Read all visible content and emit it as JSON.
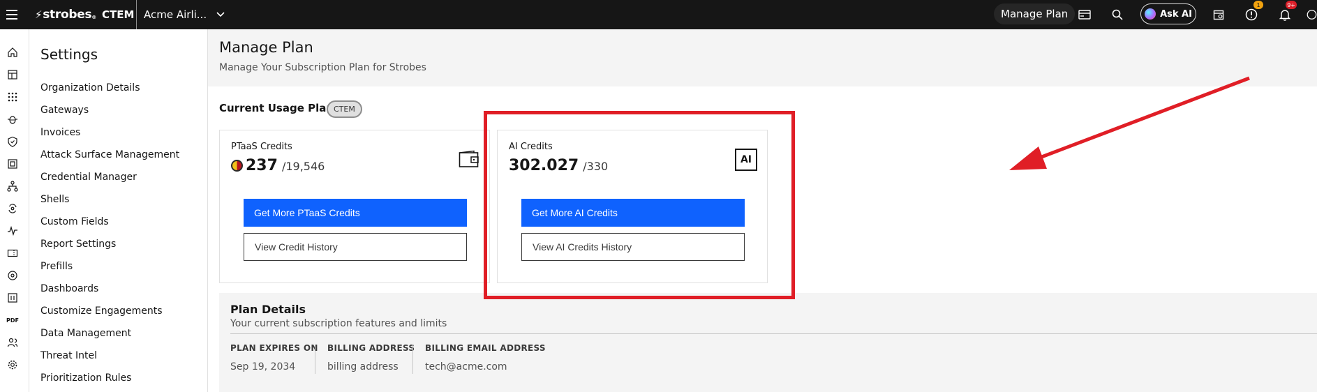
{
  "topbar": {
    "logo": "strobes",
    "product": "CTEM",
    "org": "Acme Airli...",
    "manage_plan": "Manage Plan",
    "ask_ai": "Ask AI",
    "alerts_badge": "1",
    "notifications_badge": "9+"
  },
  "sidebar": {
    "title": "Settings",
    "items": [
      "Organization Details",
      "Gateways",
      "Invoices",
      "Attack Surface Management",
      "Credential Manager",
      "Shells",
      "Custom Fields",
      "Report Settings",
      "Prefills",
      "Dashboards",
      "Customize Engagements",
      "Data Management",
      "Threat Intel",
      "Prioritization Rules"
    ]
  },
  "rail": {
    "pdf_label": "PDF"
  },
  "page": {
    "title": "Manage Plan",
    "subtitle": "Manage Your Subscription Plan for Strobes"
  },
  "usage": {
    "title": "Current Usage Plan",
    "plan_tag": "CTEM",
    "ptaas": {
      "label": "PTaaS Credits",
      "value": "237",
      "total": "/19,546",
      "primary_button": "Get More PTaaS Credits",
      "secondary_button": "View Credit History"
    },
    "ai": {
      "label": "AI Credits",
      "value": "302.027",
      "total": "/330",
      "icon_text": "AI",
      "primary_button": "Get More AI Credits",
      "secondary_button": "View AI Credits History"
    }
  },
  "plan_details": {
    "title": "Plan Details",
    "subtitle": "Your current subscription features and limits",
    "fields": [
      {
        "key": "PLAN EXPIRES ON",
        "value": "Sep 19, 2034"
      },
      {
        "key": "BILLING ADDRESS",
        "value": "billing address"
      },
      {
        "key": "BILLING EMAIL ADDRESS",
        "value": "tech@acme.com"
      }
    ]
  },
  "colors": {
    "topbar": "#161616",
    "primary": "#0f62fe",
    "annotation": "#e01e26"
  }
}
